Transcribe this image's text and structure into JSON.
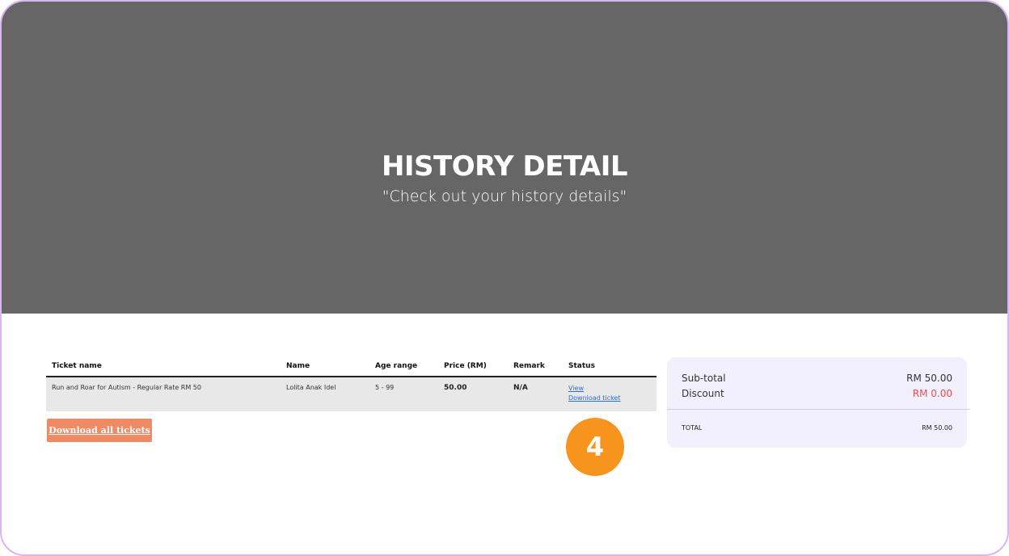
{
  "hero": {
    "title": "HISTORY DETAIL",
    "subtitle": "\"Check out your history details\""
  },
  "table": {
    "headers": [
      "Ticket name",
      "Name",
      "Age range",
      "Price (RM)",
      "Remark",
      "Status"
    ],
    "rows": [
      {
        "ticket_name": "Run and Roar for Autism - Regular Rate RM 50",
        "name": "Lolita Anak Idel",
        "age_range": "5 - 99",
        "price": "50.00",
        "remark": "N/A",
        "status_links": [
          "View",
          "Download ticket"
        ]
      }
    ]
  },
  "actions": {
    "download_all_label": "Download all tickets"
  },
  "badge": {
    "number": "4"
  },
  "summary": {
    "subtotal_label": "Sub-total",
    "subtotal_value": "RM 50.00",
    "discount_label": "Discount",
    "discount_value": "RM 0.00",
    "total_label": "TOTAL",
    "total_value": "RM 50.00"
  },
  "colors": {
    "hero_bg": "#666666",
    "button_bg": "#ef8a64",
    "badge_bg": "#f7941d",
    "discount": "#e05252",
    "link": "#2a6fd6",
    "frame_border": "#dcb4f2"
  }
}
